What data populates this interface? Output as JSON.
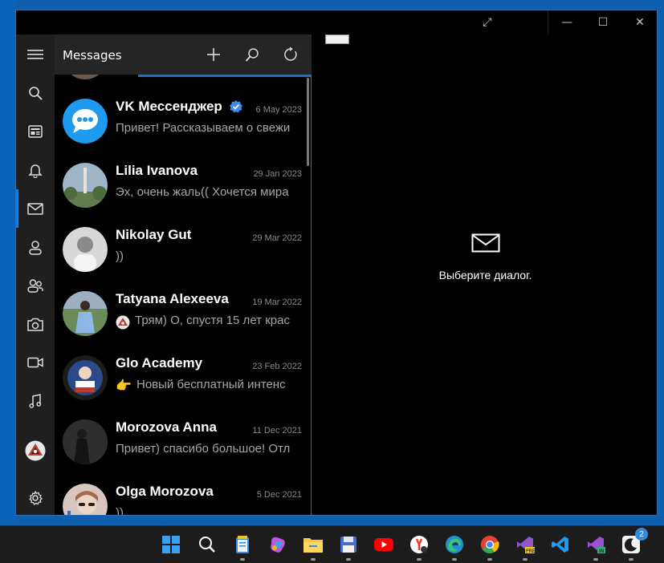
{
  "window": {
    "title_buttons": {
      "expand": "⤢",
      "minimize": "—",
      "maximize": "☐",
      "close": "✕"
    }
  },
  "rail": {
    "items": [
      {
        "icon": "hamburger-menu-icon"
      },
      {
        "icon": "search-icon"
      },
      {
        "icon": "news-icon"
      },
      {
        "icon": "bell-icon"
      },
      {
        "icon": "mail-icon",
        "active": true
      },
      {
        "icon": "person-icon"
      },
      {
        "icon": "people-icon"
      },
      {
        "icon": "camera-icon"
      },
      {
        "icon": "video-icon"
      },
      {
        "icon": "music-note-icon"
      },
      {
        "icon": "profile-avatar-icon"
      },
      {
        "icon": "gear-icon"
      }
    ]
  },
  "list": {
    "title": "Messages",
    "header_buttons": [
      "plus-icon",
      "search-icon",
      "refresh-icon"
    ],
    "conversations": [
      {
        "name": "VK Мессенджер",
        "verified": true,
        "date": "6 May 2023",
        "preview": "Привет! Рассказываем о свежи",
        "avatar_color": "#1e9bef"
      },
      {
        "name": "Lilia Ivanova",
        "verified": false,
        "date": "29 Jan 2023",
        "preview": "Эх, очень жаль(( Хочется мира",
        "avatar_color": "#6f8aa2"
      },
      {
        "name": "Nikolay Gut",
        "verified": false,
        "date": "29 Mar 2022",
        "preview": "))",
        "avatar_color": "#b5b5b5"
      },
      {
        "name": "Tatyana Alexeeva",
        "verified": false,
        "date": "19 Mar 2022",
        "preview": "Трям) О, спустя 15 лет крас",
        "avatar_color": "#5b7f5a"
      },
      {
        "name": "Glo Academy",
        "verified": false,
        "date": "23 Feb 2022",
        "preview": "Новый бесплатный интенс",
        "avatar_color": "#2a2a2a"
      },
      {
        "name": "Morozova Anna",
        "verified": false,
        "date": "11 Dec 2021",
        "preview": "Привет) спасибо большое! Отл",
        "avatar_color": "#4a4a4a"
      },
      {
        "name": "Olga Morozova",
        "verified": false,
        "date": "5 Dec 2021",
        "preview": "))",
        "avatar_color": "#c9a9a0"
      }
    ]
  },
  "detail": {
    "empty_label": "Выберите диалог."
  },
  "taskbar": {
    "items": [
      {
        "icon": "windows-start-icon",
        "color": "#3aa0f3"
      },
      {
        "icon": "search-icon",
        "color": "#ffffff"
      },
      {
        "icon": "notepad-icon",
        "color": "#f0c419"
      },
      {
        "icon": "copilot-icon",
        "color": "#c056e0"
      },
      {
        "icon": "file-explorer-icon",
        "color": "#f7c948"
      },
      {
        "icon": "floppy-save-icon",
        "color": "#4b6cc9"
      },
      {
        "icon": "youtube-icon",
        "color": "#ff0000"
      },
      {
        "icon": "yandex-browser-icon",
        "color": "#ffffff"
      },
      {
        "icon": "edge-icon",
        "color": "#2bb2e5"
      },
      {
        "icon": "chrome-icon",
        "color": "#e94235"
      },
      {
        "icon": "visual-studio-preview-icon",
        "color": "#8e56c9"
      },
      {
        "icon": "vscode-icon",
        "color": "#1f9cf0"
      },
      {
        "icon": "visual-studio-insiders-icon",
        "color": "#9b4fd3"
      },
      {
        "icon": "messenger-app-icon",
        "color": "#ffffff",
        "badge": "2"
      }
    ]
  }
}
